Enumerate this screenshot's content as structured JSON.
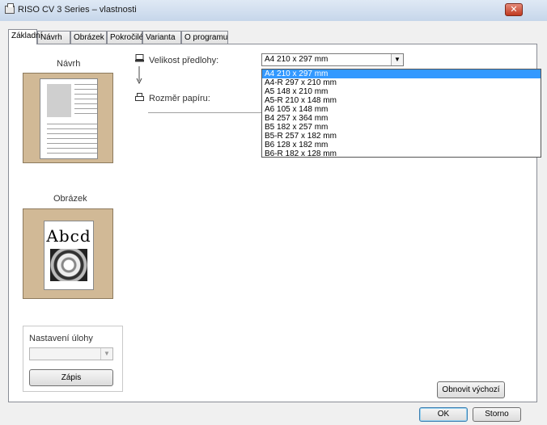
{
  "window": {
    "title": "RISO CV 3 Series – vlastnosti",
    "close_glyph": "✕"
  },
  "tabs": [
    {
      "label": "Základní",
      "active": true
    },
    {
      "label": "Návrh",
      "active": false
    },
    {
      "label": "Obrázek",
      "active": false
    },
    {
      "label": "Pokročilé",
      "active": false
    },
    {
      "label": "Varianta",
      "active": false
    },
    {
      "label": "O programu",
      "active": false
    }
  ],
  "left_panel": {
    "navrh_label": "Návrh",
    "obrazek_label": "Obrázek",
    "sample_text": "Abcd",
    "preview_color": "#d1b996"
  },
  "settings": {
    "original_size_label": "Velikost předlohy:",
    "original_size_value": "A4 210 x 297 mm",
    "paper_size_label": "Rozměr papíru:",
    "dropdown_arrow": "▼",
    "options": [
      "A4 210 x 297 mm",
      "A4-R 297 x 210 mm",
      "A5 148 x 210 mm",
      "A5-R 210 x 148 mm",
      "A6 105 x 148 mm",
      "B4 257 x 364 mm",
      "B5 182 x 257 mm",
      "B5-R 257 x 182 mm",
      "B6 128 x 182 mm",
      "B6-R 182 x 128 mm"
    ],
    "selected_index": 0,
    "selection_color": "#3399ff"
  },
  "job": {
    "group_label": "Nastavení úlohy",
    "combo_value": "",
    "combo_arrow": "▼",
    "store_button": "Zápis"
  },
  "buttons": {
    "restore_defaults": "Obnovit výchozí",
    "ok": "OK",
    "cancel": "Storno"
  }
}
